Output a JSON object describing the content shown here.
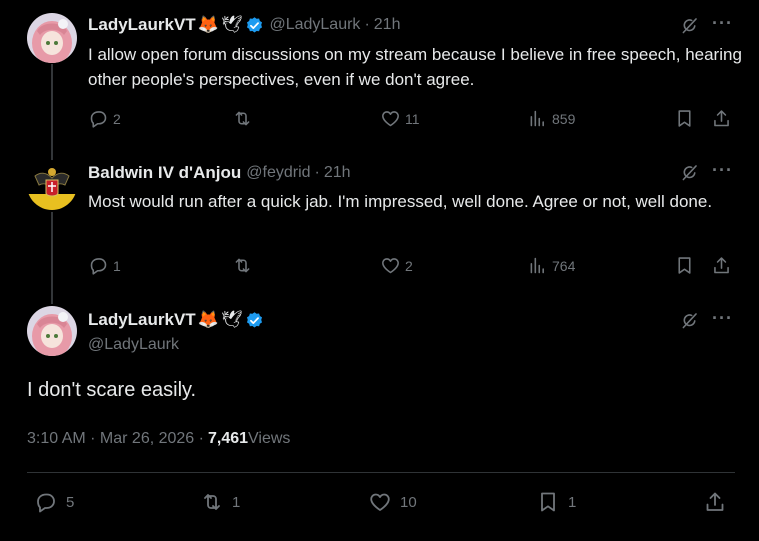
{
  "tweets": [
    {
      "display_name": "LadyLaurkVT",
      "emojis": [
        "🦊",
        "🕊"
      ],
      "handle": "@LadyLaurk",
      "separator": "·",
      "time": "21h",
      "text": "I allow open forum discussions on my stream because I believe in free speech, hearing other people's perspectives, even if we don't agree.",
      "replies": "2",
      "reposts": "",
      "likes": "11",
      "views": "859"
    },
    {
      "display_name": "Baldwin IV d'Anjou",
      "handle": "@feydrid",
      "separator": "·",
      "time": "21h",
      "text": "Most would run after a quick jab. I'm impressed, well done. Agree or not, well done.",
      "replies": "1",
      "reposts": "",
      "likes": "2",
      "views": "764"
    }
  ],
  "main_tweet": {
    "display_name": "LadyLaurkVT",
    "emojis": [
      "🦊",
      "🕊"
    ],
    "handle": "@LadyLaurk",
    "text": "I don't scare easily.",
    "timestamp": "3:10 AM · Mar 26, 2026 · ",
    "view_count": "7,461",
    "views_label": " Views",
    "replies": "5",
    "reposts": "1",
    "likes": "10",
    "bookmarks": "1"
  },
  "colors": {
    "background": "#000000",
    "text": "#e7e9ea",
    "muted": "#71767b",
    "verified": "#1d9bf0",
    "divider": "#2f3336"
  },
  "icons": [
    "reply-icon",
    "repost-icon",
    "like-icon",
    "views-icon",
    "bookmark-icon",
    "share-icon",
    "grok-icon",
    "more-icon",
    "verified-badge-icon"
  ]
}
